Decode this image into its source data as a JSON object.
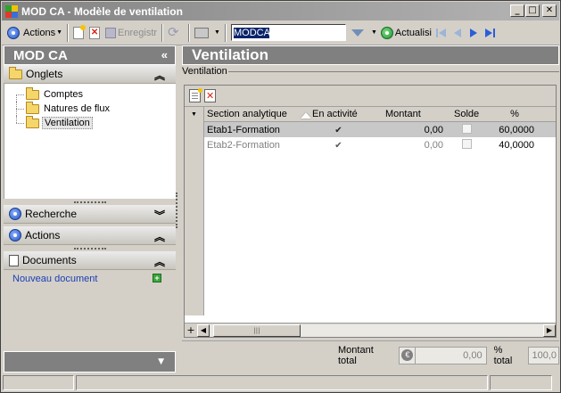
{
  "window": {
    "title": "MOD CA - Modèle de ventilation"
  },
  "toolbar": {
    "actions_label": "Actions",
    "save_label": "Enregistr",
    "search_value": "MODCA",
    "refresh_label": "Actualisi"
  },
  "left_panel": {
    "header": "MOD CA",
    "collapse_glyph": "«",
    "onglets_label": "Onglets",
    "tree": [
      {
        "label": "Comptes"
      },
      {
        "label": "Natures de flux"
      },
      {
        "label": "Ventilation"
      }
    ],
    "recherche_label": "Recherche",
    "actions_label": "Actions",
    "documents_label": "Documents",
    "new_document_label": "Nouveau document"
  },
  "right_panel": {
    "header": "Ventilation",
    "group_label": "Ventilation",
    "columns": [
      "Section analytique",
      "En activité",
      "Montant",
      "Solde",
      "%"
    ],
    "rows": [
      {
        "section": "Etab1-Formation",
        "active": "✔",
        "montant": "0,00",
        "pct": "60,0000"
      },
      {
        "section": "Etab2-Formation",
        "active": "✔",
        "montant": "0,00",
        "pct": "40,0000"
      }
    ],
    "totals": {
      "montant_label": "Montant total",
      "montant_value": "0,00",
      "pct_label": "% total",
      "pct_value": "100,0"
    }
  },
  "colors": {
    "panel_header": "#808080",
    "link": "#1a3fb4",
    "selection": "#0a246a"
  }
}
